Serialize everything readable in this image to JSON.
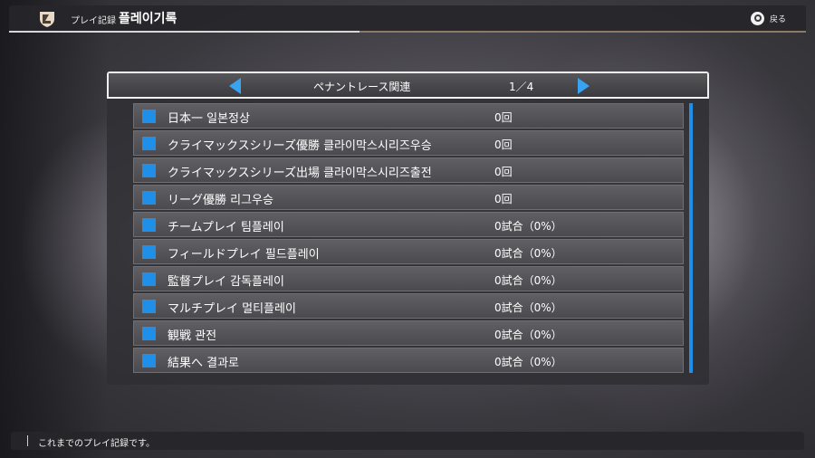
{
  "header": {
    "title_jp": "プレイ記録",
    "title_kr": "플레이기록",
    "back_label": "戻る",
    "logo_icon": "shield-logo-icon"
  },
  "panel": {
    "category": "ペナントレース関連",
    "page": "1／4",
    "prev_icon": "arrow-left-icon",
    "next_icon": "arrow-right-icon",
    "accent_color": "#1f8fe8",
    "rows": [
      {
        "label": "日本一  일본정상",
        "value": "0回"
      },
      {
        "label": "クライマックスシリーズ優勝 클라이막스시리즈우승",
        "value": "0回"
      },
      {
        "label": "クライマックスシリーズ出場 클라이막스시리즈출전",
        "value": "0回"
      },
      {
        "label": "リーグ優勝 리그우승",
        "value": "0回"
      },
      {
        "label": "チームプレイ 팀플레이",
        "value": "0試合（0%）"
      },
      {
        "label": "フィールドプレイ 필드플레이",
        "value": "0試合（0%）"
      },
      {
        "label": "監督プレイ 감독플레이",
        "value": "0試合（0%）"
      },
      {
        "label": "マルチプレイ  멀티플레이",
        "value": "0試合（0%）"
      },
      {
        "label": "観戦  관전",
        "value": "0試合（0%）"
      },
      {
        "label": "結果へ 결과로",
        "value": "0試合（0%）"
      }
    ]
  },
  "footer": {
    "text": "これまでのプレイ記録です。"
  }
}
